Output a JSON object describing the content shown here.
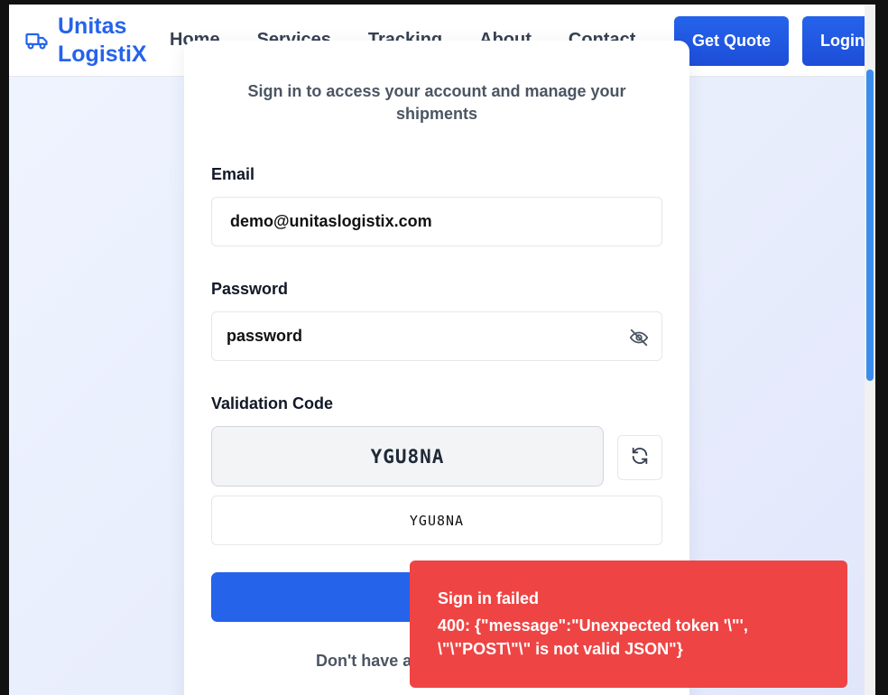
{
  "nav": {
    "brand": "Unitas LogistiX",
    "links": [
      "Home",
      "Services",
      "Tracking",
      "About",
      "Contact"
    ],
    "quote_label": "Get Quote",
    "login_label": "Login"
  },
  "form": {
    "subtitle": "Sign in to access your account and manage your shipments",
    "email_label": "Email",
    "email_value": "demo@unitaslogistix.com",
    "password_label": "Password",
    "password_value": "password",
    "validation_label": "Validation Code",
    "captcha_code": "YGU8NA",
    "code_value": "YGU8NA",
    "signup_prefix": "Don't have a"
  },
  "toast": {
    "title": "Sign in failed",
    "message": "400: {\"message\":\"Unexpected token '\\\"', \\\"\\\"POST\\\"\\\" is not valid JSON\"}"
  },
  "colors": {
    "brand": "#2563eb",
    "error": "#ef4444"
  }
}
